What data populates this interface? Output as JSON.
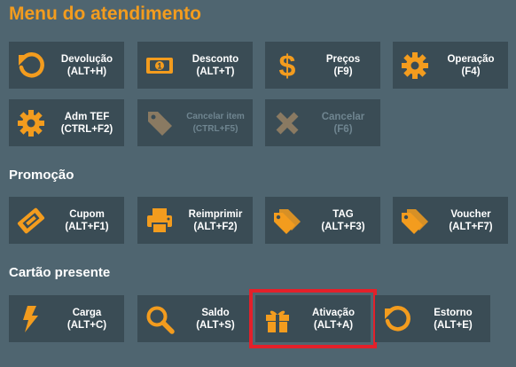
{
  "title": "Menu do atendimento",
  "colors": {
    "accent": "#f39c1e",
    "disabled_icon": "#8a7a62",
    "highlight": "#e3202a"
  },
  "sections": {
    "promocao": "Promoção",
    "cartao": "Cartão presente"
  },
  "buttons": {
    "devolucao": {
      "label": "Devolução",
      "shortcut": "(ALT+H)",
      "icon": "undo-icon"
    },
    "desconto": {
      "label": "Desconto",
      "shortcut": "(ALT+T)",
      "icon": "banknote-icon"
    },
    "precos": {
      "label": "Preços",
      "shortcut": "(F9)",
      "icon": "dollar-icon"
    },
    "operacao": {
      "label": "Operação",
      "shortcut": "(F4)",
      "icon": "gear-icon"
    },
    "admtef": {
      "label": "Adm TEF",
      "shortcut": "(CTRL+F2)",
      "icon": "gear-icon"
    },
    "cancelar_item": {
      "label": "Cancelar item",
      "shortcut": "(CTRL+F5)",
      "icon": "tag-icon"
    },
    "cancelar": {
      "label": "Cancelar",
      "shortcut": "(F6)",
      "icon": "close-icon"
    },
    "cupom": {
      "label": "Cupom",
      "shortcut": "(ALT+F1)",
      "icon": "ticket-icon"
    },
    "reimprimir": {
      "label": "Reimprimir",
      "shortcut": "(ALT+F2)",
      "icon": "printer-icon"
    },
    "tag": {
      "label": "TAG",
      "shortcut": "(ALT+F3)",
      "icon": "tags-icon"
    },
    "voucher": {
      "label": "Voucher",
      "shortcut": "(ALT+F7)",
      "icon": "tags-icon"
    },
    "carga": {
      "label": "Carga",
      "shortcut": "(ALT+C)",
      "icon": "bolt-icon"
    },
    "saldo": {
      "label": "Saldo",
      "shortcut": "(ALT+S)",
      "icon": "search-icon"
    },
    "ativacao": {
      "label": "Ativação",
      "shortcut": "(ALT+A)",
      "icon": "gift-icon"
    },
    "estorno": {
      "label": "Estorno",
      "shortcut": "(ALT+E)",
      "icon": "undo-icon"
    }
  }
}
